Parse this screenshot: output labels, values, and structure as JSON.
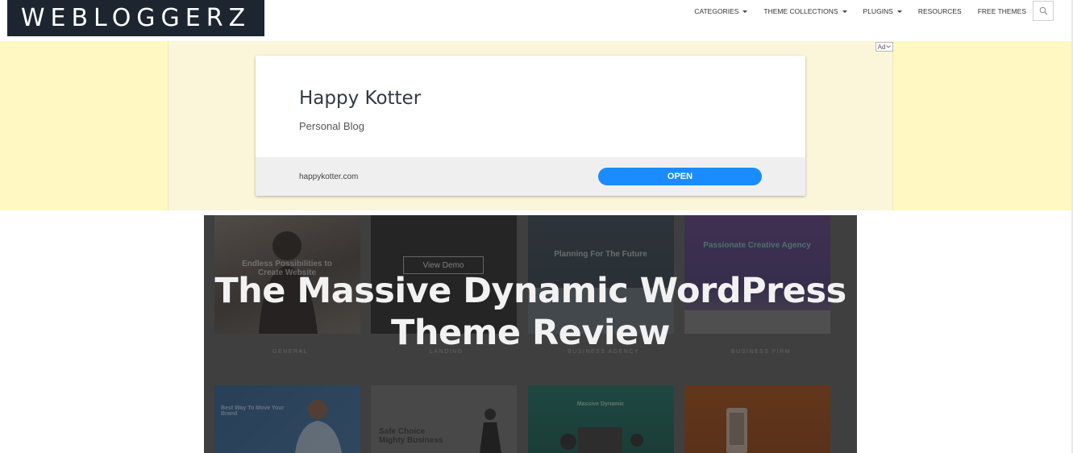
{
  "header": {
    "logo": "WEBLOGGERZ",
    "nav": [
      {
        "label": "CATEGORIES",
        "dropdown": true
      },
      {
        "label": "THEME COLLECTIONS",
        "dropdown": true
      },
      {
        "label": "PLUGINS",
        "dropdown": true
      },
      {
        "label": "RESOURCES",
        "dropdown": false
      },
      {
        "label": "FREE THEMES",
        "dropdown": false
      }
    ],
    "search_icon": "search-icon"
  },
  "ad": {
    "badge": "Ad",
    "title": "Happy Kotter",
    "subtitle": "Personal Blog",
    "url": "happykotter.com",
    "cta": "OPEN",
    "colors": {
      "band": "#fff8c2",
      "button": "#1a8cff"
    }
  },
  "hero": {
    "title": "The Massive Dynamic WordPress Theme Review",
    "tiles": {
      "t1_text": "Endless Possibilities to Create Website",
      "t2_button": "View Demo",
      "t3_text": "Planning For The Future",
      "t4_text": "Passionate Creative Agency",
      "t5_text": "Best Way To Move Your Brand",
      "t6_text": "Safe Choice Mighty Business",
      "t7_text": "Massive Dynamic"
    },
    "labels": [
      "GENERAL",
      "LANDING",
      "BUSINESS AGENCY",
      "BUSINESS FIRM"
    ]
  }
}
